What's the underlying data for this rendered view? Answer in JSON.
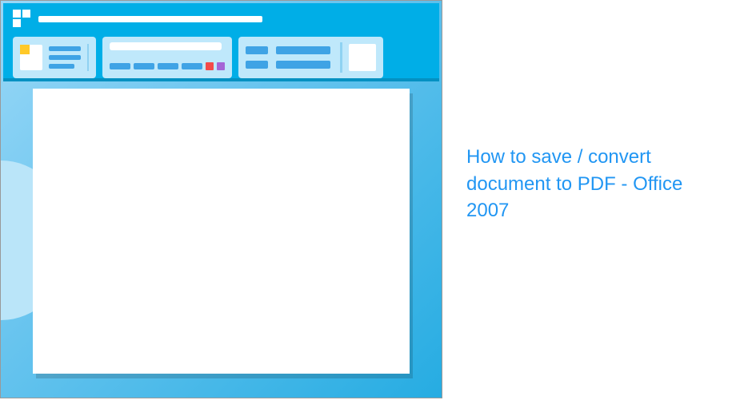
{
  "article": {
    "title": "How to save / convert document to PDF - Office 2007"
  }
}
